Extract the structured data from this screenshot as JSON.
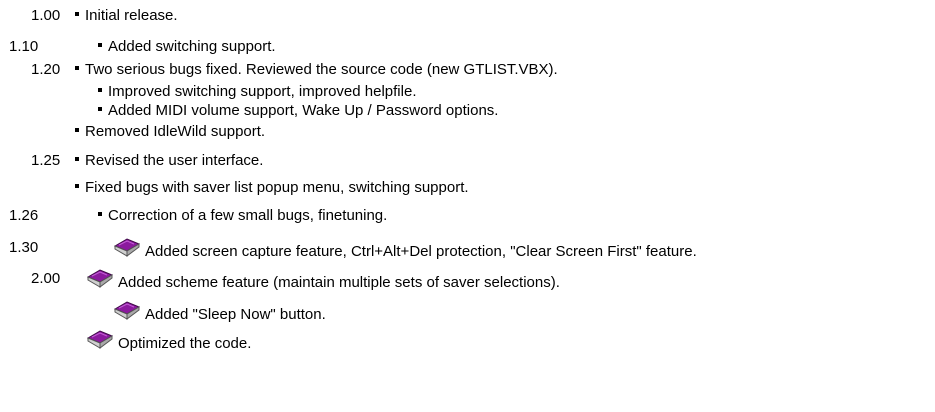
{
  "history": [
    {
      "version": "1.00",
      "text": "Initial release.",
      "icon": "bullet"
    },
    {
      "version": "1.10",
      "text": "Added switching support.",
      "icon": "bullet"
    },
    {
      "version": "1.20",
      "text": "Two serious bugs fixed. Reviewed the source code (new GTLIST.VBX).",
      "icon": "bullet"
    },
    {
      "version": "",
      "text": "Improved switching support, improved helpfile.",
      "icon": "bullet"
    },
    {
      "version": "",
      "text": "Added MIDI volume support, Wake Up / Password options.",
      "icon": "bullet"
    },
    {
      "version": "",
      "text": "Removed IdleWild support.",
      "icon": "bullet"
    },
    {
      "version": "1.25",
      "text": "Revised the user interface.",
      "icon": "bullet"
    },
    {
      "version": "",
      "text": "Fixed bugs with saver list popup menu, switching support.",
      "icon": "bullet"
    },
    {
      "version": "1.26",
      "text": "Correction of a few small bugs, finetuning.",
      "icon": "bullet"
    },
    {
      "version": "1.30",
      "text": "Added screen capture feature, Ctrl+Alt+Del protection, \"Clear Screen First\" feature.",
      "icon": "book-icon"
    },
    {
      "version": "2.00",
      "text": "Added scheme feature (maintain multiple sets of saver selections).",
      "icon": "book-icon"
    },
    {
      "version": "",
      "text": "Added \"Sleep Now\" button.",
      "icon": "book-icon"
    },
    {
      "version": "",
      "text": "Optimized the code.",
      "icon": "book-icon"
    }
  ],
  "colors": {
    "text": "#000000",
    "book_cover": "#8b1a9e",
    "book_pages": "#cfcfcf",
    "background": "#ffffff"
  }
}
